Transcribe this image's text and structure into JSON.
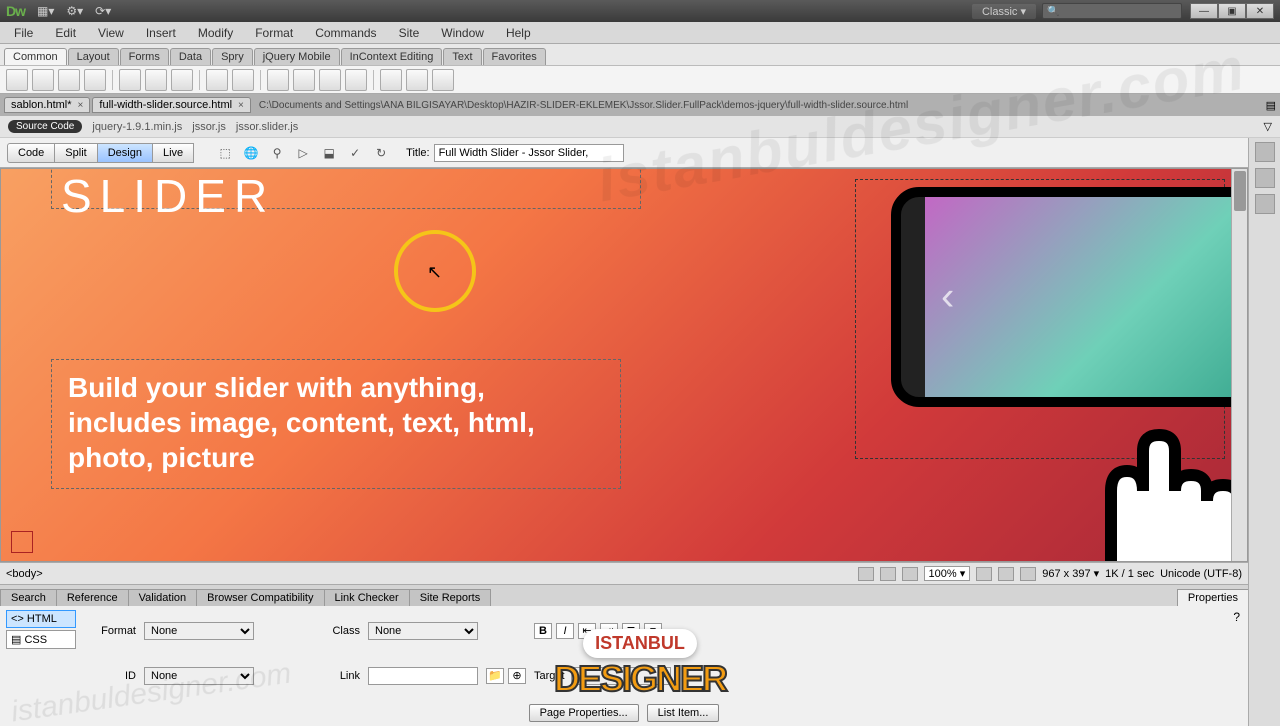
{
  "titlebar": {
    "logo": "Dw",
    "workspace": "Classic ▾",
    "search_placeholder": "🔍"
  },
  "menu": [
    "File",
    "Edit",
    "View",
    "Insert",
    "Modify",
    "Format",
    "Commands",
    "Site",
    "Window",
    "Help"
  ],
  "insert_tabs": [
    "Common",
    "Layout",
    "Forms",
    "Data",
    "Spry",
    "jQuery Mobile",
    "InContext Editing",
    "Text",
    "Favorites"
  ],
  "doc_tabs": [
    {
      "label": "sablon.html*"
    },
    {
      "label": "full-width-slider.source.html"
    }
  ],
  "doc_path": "C:\\Documents and Settings\\ANA BİLGİSAYAR\\Desktop\\HAZIR-SLIDER-EKLEMEK\\Jssor.Slider.FullPack\\demos-jquery\\full-width-slider.source.html",
  "related": {
    "source": "Source Code",
    "files": [
      "jquery-1.9.1.min.js",
      "jssor.js",
      "jssor.slider.js"
    ]
  },
  "viewbtns": [
    "Code",
    "Split",
    "Design",
    "Live"
  ],
  "title_label": "Title:",
  "title_value": "Full Width Slider - Jssor Slider,",
  "canvas": {
    "heading": "SLIDER",
    "subtext": "Build your slider with anything, includes image, content, text, html, photo, picture"
  },
  "status": {
    "tag": "<body>",
    "zoom": "100%",
    "dims": "967 x 397 ▾",
    "size": "1K / 1 sec",
    "encoding": "Unicode (UTF-8)"
  },
  "panel_tabs": [
    "Search",
    "Reference",
    "Validation",
    "Browser Compatibility",
    "Link Checker",
    "Site Reports"
  ],
  "properties_label": "Properties",
  "props": {
    "html": "<> HTML",
    "css": "▤ CSS",
    "format_label": "Format",
    "format_value": "None",
    "id_label": "ID",
    "id_value": "None",
    "class_label": "Class",
    "class_value": "None",
    "link_label": "Link",
    "link_value": "",
    "target_label": "Target",
    "target_value": ""
  },
  "bottom": {
    "page_props": "Page Properties...",
    "list_item": "List Item..."
  },
  "watermark": "istanbuldesigner.com",
  "logo": {
    "top": "ISTANBUL",
    "bottom": "DESIGNER"
  }
}
